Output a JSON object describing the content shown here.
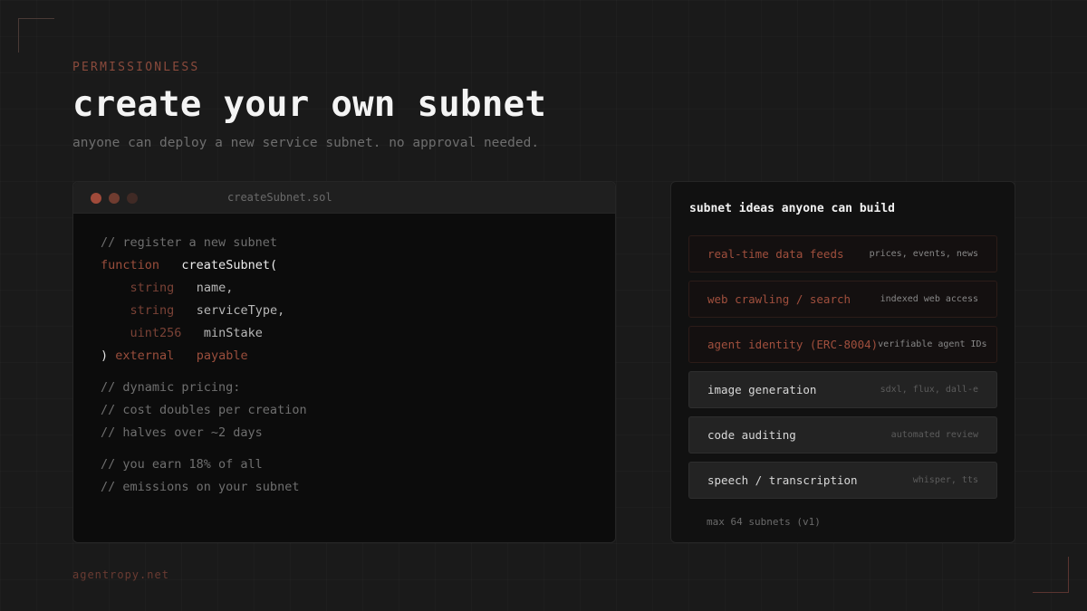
{
  "header": {
    "eyebrow": "PERMISSIONLESS",
    "title": "create your own subnet",
    "subtitle": "anyone can deploy a new service subnet. no approval needed."
  },
  "code_window": {
    "file_name": "createSubnet.sol",
    "lines": {
      "l1": "// register a new subnet",
      "l2_kw": "function",
      "l2_fn": "createSubnet(",
      "l3_type": "string",
      "l3_param": "name,",
      "l4_type": "string",
      "l4_param": "serviceType,",
      "l5_type": "uint256",
      "l5_param": "minStake",
      "l6_paren": ")",
      "l6_kw1": "external",
      "l6_kw2": "payable",
      "l7": "// dynamic pricing:",
      "l8": "// cost doubles per creation",
      "l9": "// halves over ~2 days",
      "l10": "// you earn 18% of all",
      "l11": "// emissions on your subnet"
    }
  },
  "panel": {
    "title": "subnet ideas anyone can build",
    "ideas": [
      {
        "name": "real-time data feeds",
        "desc": "prices, events, news"
      },
      {
        "name": "web crawling / search",
        "desc": "indexed web access"
      },
      {
        "name": "agent identity (ERC-8004)",
        "desc": "verifiable agent IDs"
      },
      {
        "name": "image generation",
        "desc": "sdxl, flux, dall-e"
      },
      {
        "name": "code auditing",
        "desc": "automated review"
      },
      {
        "name": "speech / transcription",
        "desc": "whisper, tts"
      }
    ],
    "footer": "max 64 subnets (v1)"
  },
  "footer": {
    "url": "agentropy.net"
  },
  "colors": {
    "accent": "#a04f3d",
    "background": "#1a1a1a"
  }
}
